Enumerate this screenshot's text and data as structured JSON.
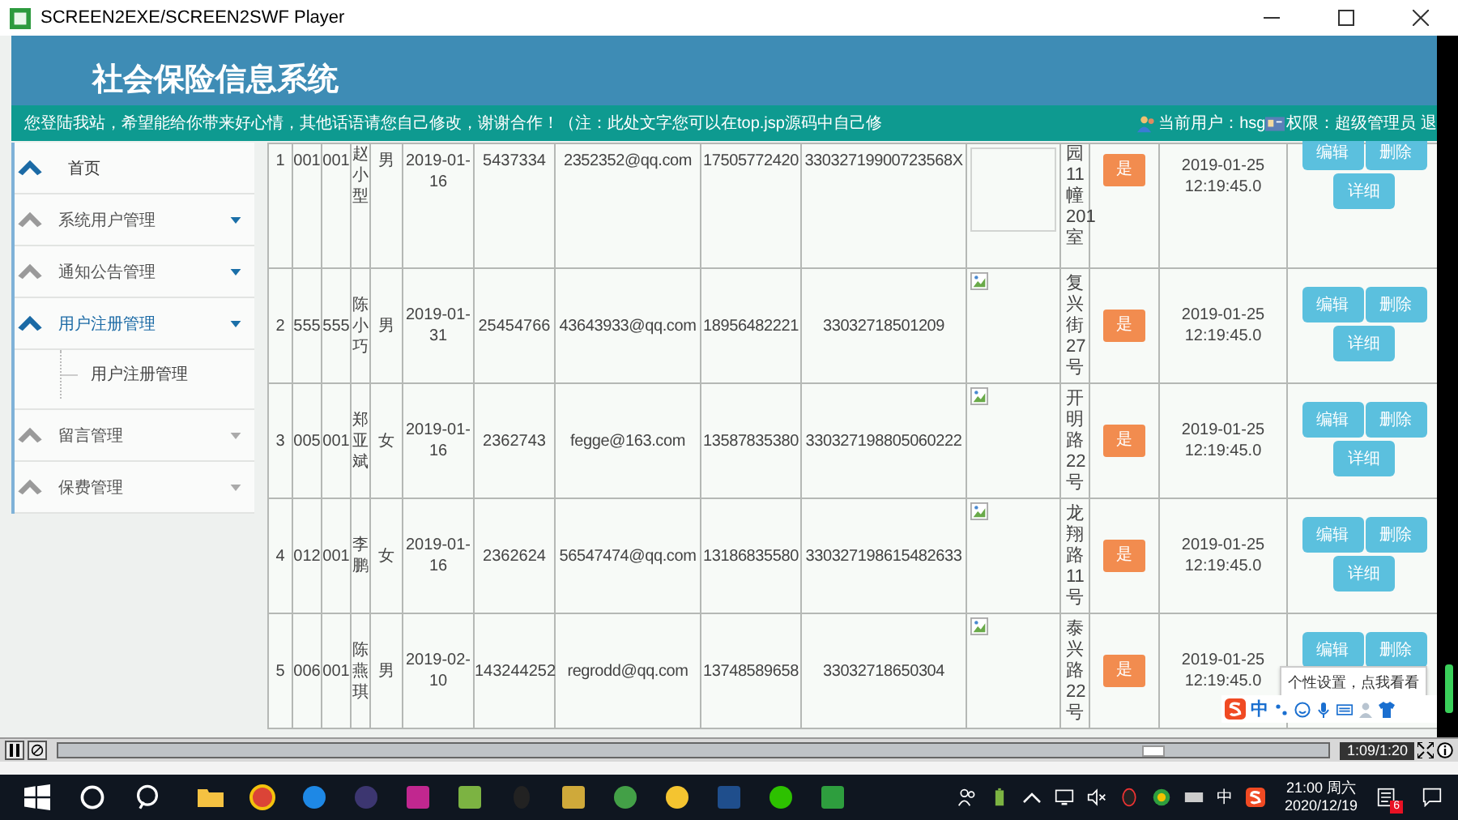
{
  "window": {
    "title": "SCREEN2EXE/SCREEN2SWF Player"
  },
  "header": {
    "title": "社会保险信息系统",
    "notice": "您登陆我站，希望能给你带来好心情，其他话语请您自己修改，谢谢合作！（注：此处文字您可以在top.jsp源码中自己修",
    "user": "当前用户：hsg",
    "role": "权限：超级管理员 退"
  },
  "sidebar": {
    "items": [
      {
        "label": "首页",
        "active": true,
        "has_menu": false
      },
      {
        "label": "系统用户管理",
        "active": false,
        "has_menu": true,
        "color": "#1a6fa8"
      },
      {
        "label": "通知公告管理",
        "active": false,
        "has_menu": true,
        "color": "#1a6fa8"
      },
      {
        "label": "用户注册管理",
        "active": true,
        "has_menu": true,
        "color": "#1a6fa8",
        "children": [
          {
            "label": "用户注册管理"
          }
        ]
      },
      {
        "label": "留言管理",
        "active": false,
        "has_menu": true,
        "color": "#aaaaaa"
      },
      {
        "label": "保费管理",
        "active": false,
        "has_menu": true,
        "color": "#aaaaaa"
      }
    ]
  },
  "table": {
    "rows": [
      {
        "cells": [
          "1",
          "001",
          "001",
          "赵小型",
          "男",
          "2019-01-16",
          "5437334",
          "2352352@qq.com",
          "17505772420",
          "33032719900723568X"
        ],
        "image_broken": false,
        "address": "园11幢201室",
        "badge": "是",
        "created": "2019-01-25 12:19:45.0",
        "actions": [
          "编辑",
          "删除",
          "详细"
        ]
      },
      {
        "cells": [
          "2",
          "555",
          "555",
          "陈小巧",
          "男",
          "2019-01-31",
          "25454766",
          "43643933@qq.com",
          "18956482221",
          "33032718501209"
        ],
        "image_broken": true,
        "address": "复兴街27号",
        "badge": "是",
        "created": "2019-01-25 12:19:45.0",
        "actions": [
          "编辑",
          "删除",
          "详细"
        ]
      },
      {
        "cells": [
          "3",
          "005",
          "001",
          "郑亚斌",
          "女",
          "2019-01-16",
          "2362743",
          "fegge@163.com",
          "13587835380",
          "330327198805060222"
        ],
        "image_broken": true,
        "address": "开明路22号",
        "badge": "是",
        "created": "2019-01-25 12:19:45.0",
        "actions": [
          "编辑",
          "删除",
          "详细"
        ]
      },
      {
        "cells": [
          "4",
          "012",
          "001",
          "李鹏",
          "女",
          "2019-01-16",
          "2362624",
          "56547474@qq.com",
          "13186835580",
          "330327198615482633"
        ],
        "image_broken": true,
        "address": "龙翔路11号",
        "badge": "是",
        "created": "2019-01-25 12:19:45.0",
        "actions": [
          "编辑",
          "删除",
          "详细"
        ]
      },
      {
        "cells": [
          "5",
          "006",
          "001",
          "陈燕琪",
          "男",
          "2019-02-10",
          "143244252",
          "regrodd@qq.com",
          "13748589658",
          "33032718650304"
        ],
        "image_broken": true,
        "address": "泰兴路22号",
        "badge": "是",
        "created": "2019-01-25 12:19:45.0",
        "actions": [
          "编辑",
          "删除"
        ]
      }
    ]
  },
  "tooltip": "个性设置，点我看看",
  "ime_bar": {
    "mode": "中"
  },
  "player": {
    "level": 0.86,
    "time": "1:09/1:20"
  },
  "taskbar": {
    "ime": "中",
    "time": "21:00 周六",
    "date": "2020/12/19",
    "notifications": "6"
  }
}
